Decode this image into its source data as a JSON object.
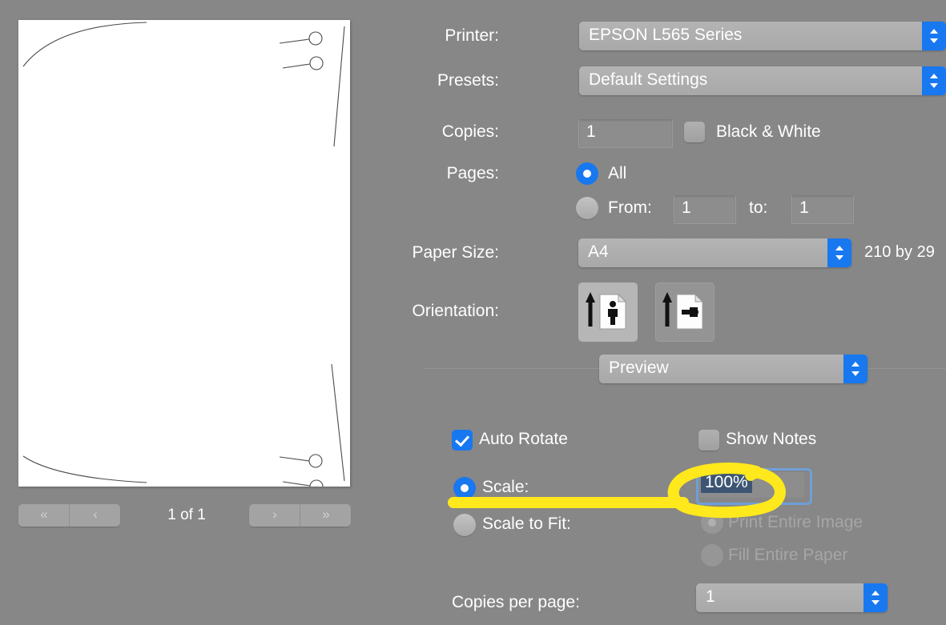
{
  "preview": {
    "page_indicator": "1 of 1",
    "nav_buttons": [
      {
        "name": "first-page-button",
        "glyph": "«"
      },
      {
        "name": "previous-page-button",
        "glyph": "‹"
      },
      {
        "name": "next-page-button",
        "glyph": "›"
      },
      {
        "name": "last-page-button",
        "glyph": "»"
      }
    ]
  },
  "settings": {
    "printer": {
      "label": "Printer:",
      "value": "EPSON L565 Series"
    },
    "presets": {
      "label": "Presets:",
      "value": "Default Settings"
    },
    "copies": {
      "label": "Copies:",
      "value": "1"
    },
    "black_and_white": {
      "label": "Black & White",
      "checked": false
    },
    "pages": {
      "label": "Pages:",
      "all_label": "All",
      "all_selected": true,
      "from_label": "From:",
      "from_value": "1",
      "to_label": "to:",
      "to_value": "1",
      "range_selected": false
    },
    "paper_size": {
      "label": "Paper Size:",
      "value": "A4",
      "dimensions": "210 by 29"
    },
    "orientation": {
      "label": "Orientation:",
      "portrait_selected": true,
      "landscape_selected": false
    },
    "pane_popup": {
      "value": "Preview"
    },
    "auto_rotate": {
      "label": "Auto Rotate",
      "checked": true
    },
    "show_notes": {
      "label": "Show Notes",
      "checked": false
    },
    "scale": {
      "label": "Scale:",
      "selected": true,
      "value": "100%",
      "value_is_selected_text": true,
      "field_focused": true
    },
    "scale_to_fit": {
      "label": "Scale to Fit:",
      "selected": false
    },
    "print_entire_image": {
      "label": "Print Entire Image",
      "selected": true,
      "disabled": true
    },
    "fill_entire_paper": {
      "label": "Fill Entire Paper",
      "selected": false,
      "disabled": true
    },
    "copies_per_page": {
      "label": "Copies per page:",
      "value": "1"
    }
  },
  "annotations": {
    "highlight_color": "#FFE81C",
    "ellipse_target": "scale-value-field",
    "underline_target": "scale-radio-row"
  },
  "colors": {
    "window_background": "#878787",
    "accent_blue": "#1878f0",
    "control_gray": "#a8a8a8",
    "text_white": "#ffffff",
    "selection_navy": "#3d5573",
    "focus_ring_blue": "#6f9fd8",
    "annotation_yellow": "#FFE81C"
  }
}
